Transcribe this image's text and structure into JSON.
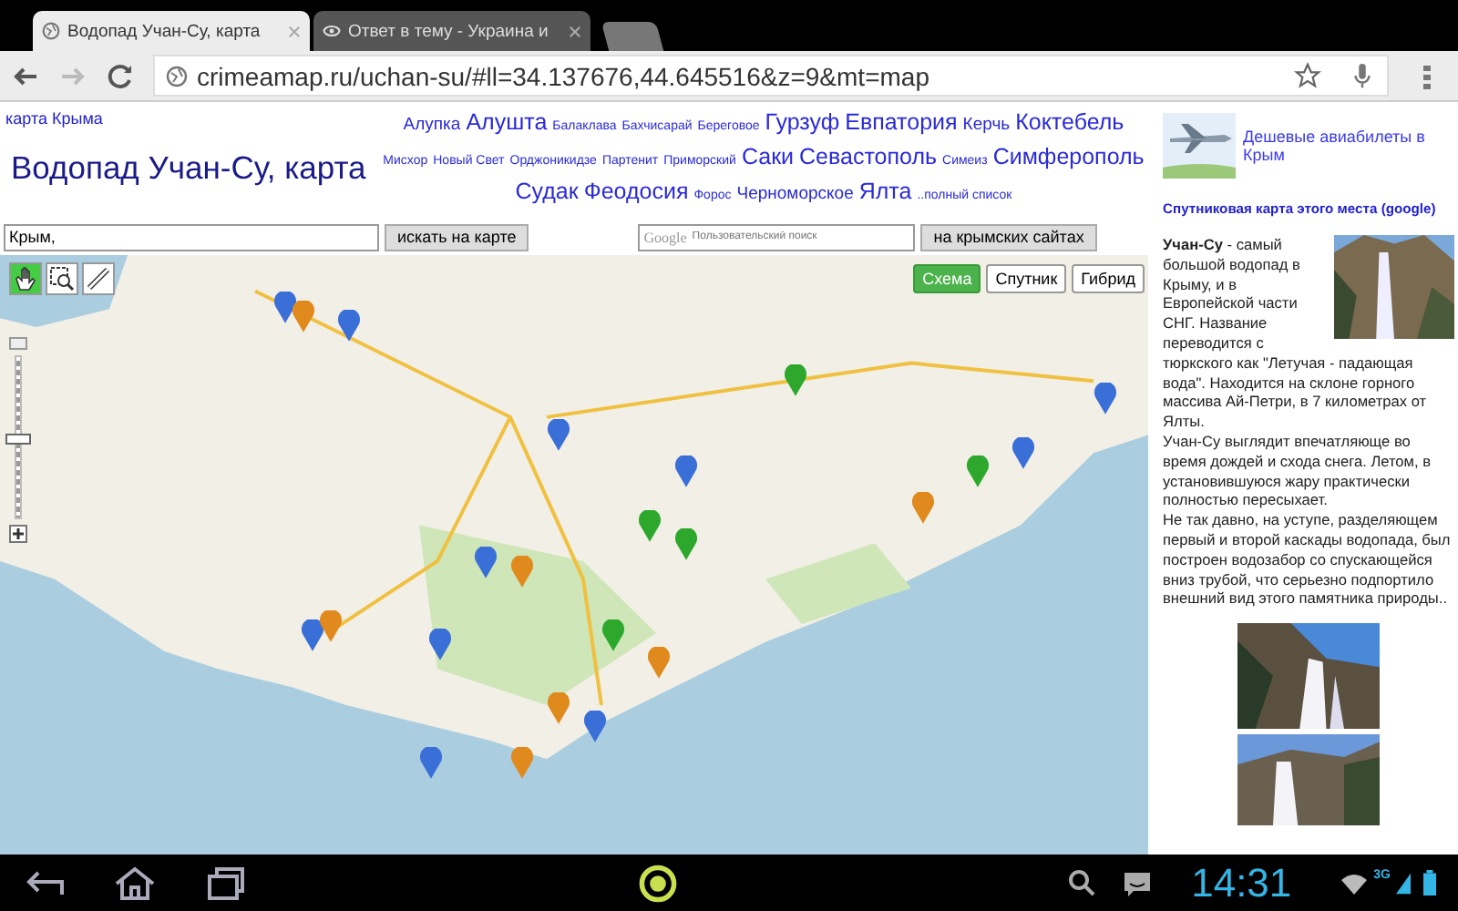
{
  "browser": {
    "tabs": [
      {
        "title": "Водопад Учан-Су, карта",
        "selected": true
      },
      {
        "title": "Ответ в тему - Украина и",
        "selected": false
      }
    ],
    "forward_disabled": true,
    "url": "crimeamap.ru/uchan-su/#ll=34.137676,44.645516&z=9&mt=map"
  },
  "page": {
    "breadcrumb": "карта Крыма",
    "title": "Водопад Учан-Су, карта",
    "places": [
      {
        "label": "Алупка",
        "kind": "medium"
      },
      {
        "label": "Алушта",
        "kind": "large"
      },
      {
        "label": "Балаклава",
        "kind": "small"
      },
      {
        "label": "Бахчисарай",
        "kind": "small"
      },
      {
        "label": "Береговое",
        "kind": "small"
      },
      {
        "label": "Гурзуф",
        "kind": "large"
      },
      {
        "label": "Евпатория",
        "kind": "large"
      },
      {
        "label": "Керчь",
        "kind": "medium"
      },
      {
        "label": "Коктебель",
        "kind": "large"
      },
      {
        "label": "Мисхор",
        "kind": "small"
      },
      {
        "label": "Новый Свет",
        "kind": "small"
      },
      {
        "label": "Орджоникидзе",
        "kind": "small"
      },
      {
        "label": "Партенит",
        "kind": "small"
      },
      {
        "label": "Приморский",
        "kind": "small"
      },
      {
        "label": "Саки",
        "kind": "large"
      },
      {
        "label": "Севастополь",
        "kind": "large"
      },
      {
        "label": "Симеиз",
        "kind": "small"
      },
      {
        "label": "Симферополь",
        "kind": "large"
      },
      {
        "label": "Судак",
        "kind": "large"
      },
      {
        "label": "Феодосия",
        "kind": "large"
      },
      {
        "label": "Форос",
        "kind": "small"
      },
      {
        "label": "Черноморское",
        "kind": "medium"
      },
      {
        "label": "Ялта",
        "kind": "large"
      },
      {
        "label": "..полный список",
        "kind": "small"
      }
    ],
    "map_search": {
      "value": "Крым,",
      "button": "искать на карте"
    },
    "site_search": {
      "brand": "Google",
      "placeholder": "Пользовательский поиск",
      "button": "на крымских сайтах"
    },
    "map_types": [
      {
        "label": "Схема",
        "selected": true
      },
      {
        "label": "Спутник",
        "selected": false
      },
      {
        "label": "Гибрид",
        "selected": false
      }
    ],
    "map_zoom": {
      "level": 0.5
    }
  },
  "sidebar": {
    "ad": "Дешевые авиабилеты в Крым",
    "satellite_link": "Спутниковая карта этого места (google)",
    "beside_photo": "**Учан-Су** - самый большой водопад в Крыму, и в Европейской части СНГ. Название переводится с",
    "paragraphs": [
      "тюркского как \"Летучая - падающая вода\". Находится на склоне горного массива Ай-Петри, в 7 километрах от Ялты.",
      "Учан-Су выглядит впечатляюще во время дождей и схода снега. Летом, в установившуюся жару практически полностью пересыхает.",
      "Не так давно, на уступе, разделяющем первый и второй каскады водопада, был построен водозабор со спускающейся вниз трубой, что серьезно подпортило внешний вид этого памятника природы.."
    ]
  },
  "status_bar": {
    "network": "3G",
    "time": "14:31"
  }
}
